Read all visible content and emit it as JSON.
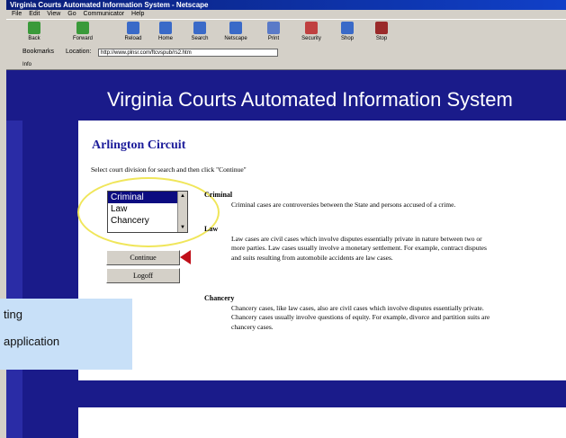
{
  "window": {
    "title": "Virginia Courts Automated Information System - Netscape"
  },
  "menu": [
    "File",
    "Edit",
    "View",
    "Go",
    "Communicator",
    "Help"
  ],
  "toolbar": [
    "Back",
    "Forward",
    "Reload",
    "Home",
    "Search",
    "Netscape",
    "Print",
    "Security",
    "Shop",
    "Stop"
  ],
  "location": {
    "bookmarks_label": "Bookmarks",
    "location_label": "Location:",
    "url": "http://www.plnsr.com/ftcvspub/rs2.htm"
  },
  "info_label": "Info",
  "page": {
    "site_title": "Virginia Courts Automated Information System",
    "heading": "Arlington Circuit",
    "instruction": "Select court division for search and then click \"Continue\"",
    "divisions": [
      "Criminal",
      "Law",
      "Chancery"
    ],
    "selected_index": 0,
    "continue_label": "Continue",
    "logoff_label": "Logoff"
  },
  "descriptions": [
    {
      "title": "Criminal",
      "text": "Criminal cases are controversies between the State and persons accused of a crime."
    },
    {
      "title": "Law",
      "text": "Law cases are civil cases which involve disputes essentially private in nature between two or more parties. Law cases usually involve a monetary settlement. For example, contract disputes and suits resulting from automobile accidents are law cases."
    },
    {
      "title": "Chancery",
      "text": "Chancery cases, like law cases, also are civil cases which involve disputes essentially private. Chancery cases usually involve questions of equity. For example, divorce and partition suits are chancery cases."
    }
  ],
  "callout": {
    "line1": "ting",
    "line2": "application"
  },
  "colors": {
    "banner": "#1a1b8a",
    "highlight_ellipse": "#f0e65a",
    "pointer_arrow": "#c0101a",
    "callout_bg": "#c8e0f8"
  }
}
